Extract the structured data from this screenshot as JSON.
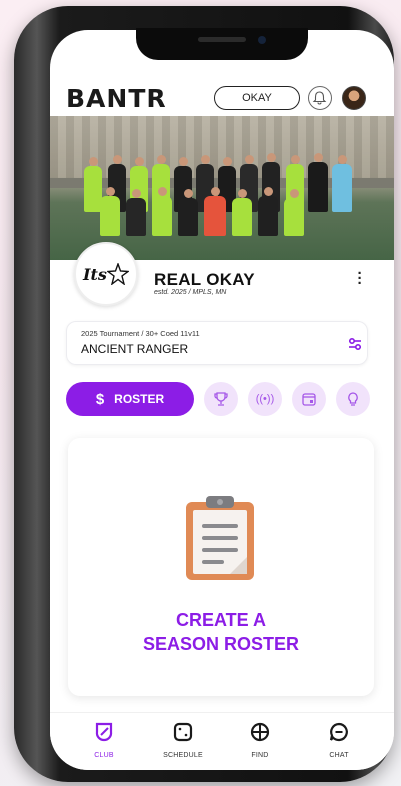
{
  "header": {
    "logo": "BANTR",
    "team_selector": "OKAY"
  },
  "club": {
    "crest_text": "Its",
    "name": "REAL OKAY",
    "subtitle": "estd. 2025 / MPLS, MN"
  },
  "tournament": {
    "label": "2025 Tournament / 30+ Coed 11v11",
    "name": "ANCIENT RANGER"
  },
  "actions": {
    "roster_icon": "$",
    "roster_label": "ROSTER",
    "icons": [
      "trophy-icon",
      "broadcast-icon",
      "calendar-icon",
      "lightbulb-icon"
    ]
  },
  "empty_state": {
    "line1": "CREATE A",
    "line2": "SEASON ROSTER"
  },
  "nav": {
    "items": [
      {
        "label": "CLUB",
        "icon": "club-shield-icon"
      },
      {
        "label": "SCHEDULE",
        "icon": "schedule-icon"
      },
      {
        "label": "FIND",
        "icon": "globe-icon"
      },
      {
        "label": "CHAT",
        "icon": "chat-icon"
      }
    ]
  },
  "colors": {
    "accent": "#8c1de6",
    "accent_soft": "#f1e3fb",
    "clipboard": "#e08a55"
  }
}
